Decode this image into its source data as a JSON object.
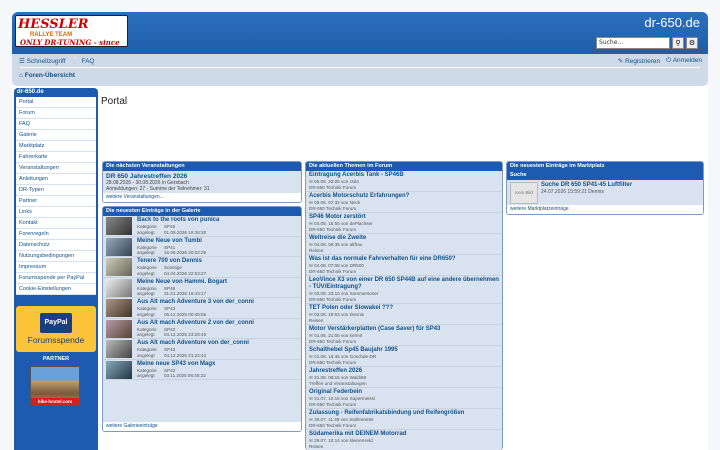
{
  "header": {
    "site_title": "dr-650.de",
    "logo": {
      "line1": "HESSLER",
      "line2": "RALLYE TEAM",
      "line3": "ONLY DR-TUNING - since 1990"
    },
    "search_placeholder": "Suche...",
    "search_icon": "search-icon",
    "advanced_icon": "gear-icon"
  },
  "nav": {
    "quicklinks": "Schnellzugriff",
    "faq": "FAQ",
    "register": "Registrieren",
    "login": "Anmelden",
    "breadcrumb": "Foren-Übersicht"
  },
  "page": {
    "title": "Portal"
  },
  "sidebar": {
    "title": "dr-650.de",
    "items": [
      "Portal",
      "Forum",
      "FAQ",
      "Galerie",
      "Marktplatz",
      "Fahrerkarte",
      "Veranstaltungen",
      "Anleitungen",
      "DR-Typen",
      "Partner",
      "Links",
      "Kontakt",
      "Forenregeln",
      "Datenschutz",
      "Nutzungsbedingungen",
      "Impressum",
      "Forumsspende per PayPal",
      "Cookie-Einstellungen"
    ],
    "paypal_logo": "PayPal",
    "paypal_label": "Forumsspende",
    "partner_label": "PARTNER",
    "partner_caption": "bike-hostel.com"
  },
  "events": {
    "header": "Die nächsten Veranstaltungen",
    "title": "DR 650 Jahrestreffen 2026",
    "line1": "28.08.2026 - 30.08.2026 in Gersbach",
    "line2": "Anmeldungen: 27 - Summe der Teilnehmer: 31",
    "footer": "weitere Veranstaltungen..."
  },
  "gallery": {
    "header": "Die neuesten Einträge in der Galerie",
    "label_category": "Kategorie",
    "label_added": "angelegt",
    "items": [
      {
        "title": "Back to the roots von punica",
        "category": "SP46",
        "date": "01.08.2026 19:38:30"
      },
      {
        "title": "Meine Neue von Tumbi",
        "category": "SP41",
        "date": "15.06.2026 20:02:29"
      },
      {
        "title": "Tenere 700 von Dennis",
        "category": "Sonstige",
        "date": "04.04.2026 22:53:27"
      },
      {
        "title": "Meine Neue von Hammi. Bogart",
        "category": "SP46",
        "date": "31.01.2026 19:43:17"
      },
      {
        "title": "Aus Alt mach Adventure 3 von der_conni",
        "category": "SP43",
        "date": "06.12.2025 00:45:55"
      },
      {
        "title": "Aus Alt mach Adventure 2 von der_conni",
        "category": "SP43",
        "date": "04.12.2025 23:20:49"
      },
      {
        "title": "Aus Alt mach Adventure von der_conni",
        "category": "SP43",
        "date": "04.12.2025 21:22:42"
      },
      {
        "title": "Meine neue SP43 von Magx",
        "category": "SP43",
        "date": "03.11.2025 06:45:22"
      }
    ],
    "footer": "weitere Galerieeinträge"
  },
  "topics": {
    "header": "Die aktuellen Themen im Forum",
    "items": [
      {
        "title": "Eintragung Acerbis Tank - SP46B",
        "meta": "05.08. 22:05 von r3d4",
        "forum": "DR-650 Technik Forum"
      },
      {
        "title": "Acerbis Motorschutz Erfahrungen?",
        "meta": "05.08. 07:32 von Neck",
        "forum": "DR-650 Technik Forum"
      },
      {
        "title": "SP46 Motor zerstört",
        "meta": "04.08. 15:55 von dePlachser",
        "forum": "DR-650 Technik Forum"
      },
      {
        "title": "Weltreise die Zweite",
        "meta": "04.08. 09:35 von altfrau",
        "forum": "Reisen"
      },
      {
        "title": "Was ist das normale Fahrverhalten für eine DR650?",
        "meta": "04.08. 07:08 von DR500",
        "forum": "DR-650 Technik Forum"
      },
      {
        "title": "LeoVince X3 von einer DR 650 SP44B auf eine andere übernehmen - TÜV/Eintragung?",
        "meta": "03.08. 23:10 von Sommersoner",
        "forum": "DR-650 Technik Forum"
      },
      {
        "title": "TET Polen oder Slowakei ???",
        "meta": "03.08. 19:53 von Dennis",
        "forum": "Reisen"
      },
      {
        "title": "Motor Verstärkerplatten (Case Saver) für SP43",
        "meta": "01.08. 21:06 von kermit",
        "forum": "DR-650 Technik Forum"
      },
      {
        "title": "Schalthebel Sp45 Baujahr 1995",
        "meta": "01.08. 16:45 von Goschde-DR",
        "forum": "DR-650 Technik Forum"
      },
      {
        "title": "Jahrestreffen 2026",
        "meta": "31.08. 06:15 von Waldi69",
        "forum": "Treffen und Veranstaltungen"
      },
      {
        "title": "Original Federbein",
        "meta": "31.07. 10:15 von Supermeissl",
        "forum": "DR-650 Technik Forum"
      },
      {
        "title": "Zulassung - Reifenfabrikatsbindung und Reifengrößen",
        "meta": "30.07. 11:49 von Stollenreiter",
        "forum": "DR-650 Technik Forum"
      },
      {
        "title": "Südamerika mit DEINEM Motorrad",
        "meta": "29.07. 10:14 von kleinerHeld",
        "forum": "Reisen"
      }
    ]
  },
  "market": {
    "header": "Die neuesten Einträge im Marktplatz",
    "subheader": "Suche",
    "no_image": "Kein Bild",
    "title": "Suche DR 650 SP41-45 Luftfilter",
    "date": "24.07.2026 15:59:21 Dennis",
    "footer": "weitere Marktplatzeinträge"
  }
}
